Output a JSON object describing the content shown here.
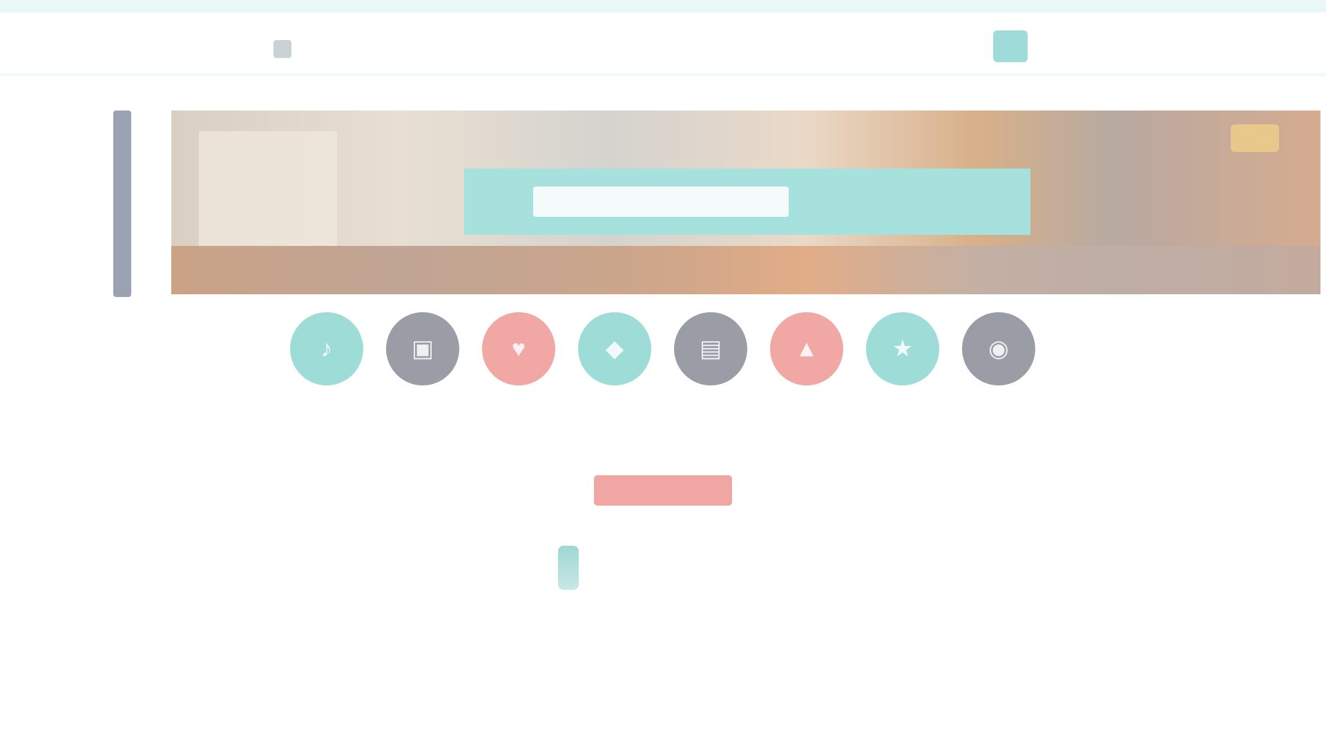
{
  "header": {
    "logo_text": "",
    "cart_label": "",
    "subnav": []
  },
  "sidebar": {
    "cells": [
      "",
      "",
      "",
      "",
      "",
      "",
      "",
      "",
      "",
      "",
      "",
      "",
      "",
      "",
      "",
      "",
      "",
      "",
      "",
      "",
      "",
      ""
    ]
  },
  "hero": {
    "search_placeholder": ""
  },
  "categories": [
    {
      "icon": "music-note-icon",
      "glyph": "♪",
      "color": "#9edcd8",
      "label": "",
      "count": ""
    },
    {
      "icon": "bag-icon",
      "glyph": "▣",
      "color": "#9a9da5",
      "label": "",
      "count": ""
    },
    {
      "icon": "heart-icon",
      "glyph": "♥",
      "color": "#f1a7a4",
      "label": "",
      "count": ""
    },
    {
      "icon": "tag-icon",
      "glyph": "◆",
      "color": "#9edcd8",
      "label": "",
      "count": ""
    },
    {
      "icon": "gift-icon",
      "glyph": "▤",
      "color": "#9a9da5",
      "label": "",
      "count": ""
    },
    {
      "icon": "home-icon",
      "glyph": "▲",
      "color": "#f1a7a4",
      "label": "",
      "count": ""
    },
    {
      "icon": "star-icon",
      "glyph": "★",
      "color": "#9edcd8",
      "label": "",
      "count": ""
    },
    {
      "icon": "camera-icon",
      "glyph": "◉",
      "color": "#9a9da5",
      "label": "",
      "count": ""
    }
  ],
  "cta": {
    "label": ""
  },
  "brand": {
    "name": "",
    "subtitle": ""
  },
  "colors": {
    "accent": "#9edcd8",
    "pink": "#f1a7a4",
    "gray": "#9a9da5"
  }
}
